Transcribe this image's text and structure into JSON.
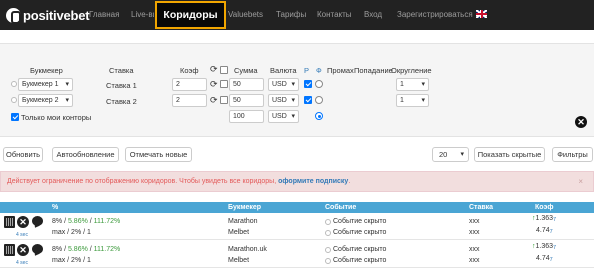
{
  "nav": {
    "logo": "positivebet",
    "items": [
      "Главная",
      "Live-вилки",
      "Valuebets",
      "Тарифы",
      "Контакты",
      "Вход",
      "Зарегистрироваться"
    ],
    "active": "Коридоры",
    "language": "english-flag-icon"
  },
  "filter": {
    "headers": {
      "bookmaker": "Букмекер",
      "bet": "Ставка",
      "coef": "Коэф",
      "sum": "Сумма",
      "currency": "Валюта",
      "p": "P",
      "phi": "Ф",
      "promah": "Промах",
      "hit": "Попадание",
      "rounding": "Округление"
    },
    "rows": [
      {
        "bookmaker": "Букмекер 1",
        "bet": "Ставка 1",
        "coef": "2",
        "sum": "50",
        "currency": "USD",
        "p_checked": true,
        "rounding": "1"
      },
      {
        "bookmaker": "Букмекер 2",
        "bet": "Ставка 2",
        "coef": "2",
        "sum": "50",
        "currency": "USD",
        "p_checked": true,
        "rounding": "1"
      }
    ],
    "total": {
      "sum": "100",
      "currency": "USD"
    },
    "only_mine_label": "Только мои конторы",
    "only_mine_checked": true
  },
  "toolbar": {
    "refresh": "Обновить",
    "autorefresh": "Автообновление",
    "mark_new": "Отмечать новые",
    "page_size": "20",
    "show_hidden": "Показать скрытые",
    "filters": "Фильтры"
  },
  "alert": {
    "text": "Действует ограничение по отображению коридоров. Чтобы увидеть все коридоры,",
    "link": "оформите подписку",
    "tail": ".",
    "close": "×"
  },
  "table": {
    "headers": [
      "%",
      "Букмекер",
      "Событие",
      "Ставка",
      "Коэф"
    ],
    "rows": [
      {
        "percent_a": "8%",
        "percent_b": "5.86%",
        "percent_c": "111.72%",
        "line2": "max / 2% / 1",
        "secs": "4 sec",
        "bookmaker1": "Marathon",
        "bookmaker2": "Melbet",
        "event1": "Событие скрыто",
        "event2": "Событие скрыто",
        "bet1": "xxx",
        "bet2": "xxx",
        "coef1": "1.363",
        "coef2": "4.74"
      },
      {
        "percent_a": "8%",
        "percent_b": "5.86%",
        "percent_c": "111.72%",
        "line2": "max / 2% / 1",
        "secs": "4 sec",
        "bookmaker1": "Marathon.uk",
        "bookmaker2": "Melbet",
        "event1": "Событие скрыто",
        "event2": "Событие скрыто",
        "bet1": "xxx",
        "bet2": "xxx",
        "coef1": "1.363",
        "coef2": "4.74"
      }
    ],
    "coef_sub1": "7",
    "coef_sub2": "7"
  },
  "colors": {
    "navbar": "#222222",
    "active_border": "#f0a500",
    "table_header": "#4aa5d4",
    "alert_bg": "#f2dede",
    "alert_text": "#e35a5a",
    "link": "#337ab7"
  }
}
